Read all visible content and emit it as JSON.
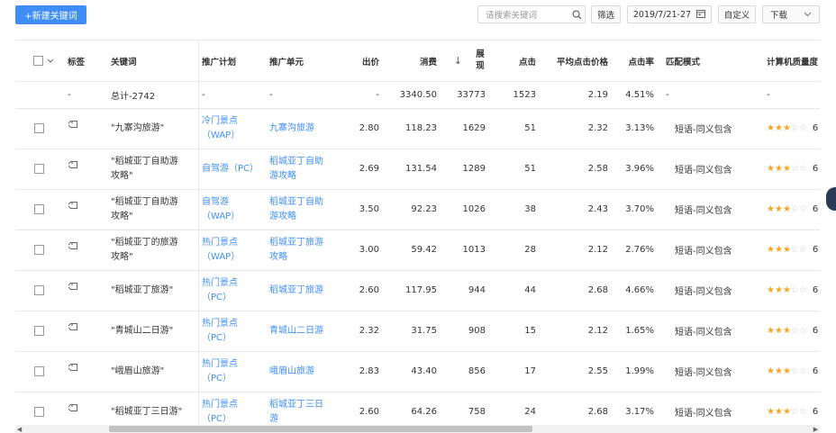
{
  "toolbar": {
    "new_keyword_label": "+新建关键词",
    "search_placeholder": "请搜索关键词",
    "filter_label": "筛选",
    "date_label": "2019/7/21-27",
    "custom_label": "自定义",
    "download_label": "下载"
  },
  "table": {
    "headers": {
      "tag": "标签",
      "keyword": "关键词",
      "plan": "推广计划",
      "unit": "推广单元",
      "bid": "出价",
      "spend": "消费",
      "impressions": "展现",
      "clicks": "点击",
      "avg_cpc": "平均点击价格",
      "ctr": "点击率",
      "match": "匹配模式",
      "quality": "计算机质量度"
    },
    "total": {
      "tag": "-",
      "keyword": "总计-2742",
      "plan": "-",
      "unit": "-",
      "bid": "-",
      "spend": "3340.50",
      "impressions": "33773",
      "clicks": "1523",
      "avg_cpc": "2.19",
      "ctr": "4.51%",
      "match": "-",
      "quality": "-"
    },
    "rows": [
      {
        "keyword": "\"九寨沟旅游\"",
        "plan": "冷门景点（WAP）",
        "unit": "九寨沟旅游",
        "bid": "2.80",
        "spend": "118.23",
        "impressions": "1629",
        "clicks": "51",
        "avg_cpc": "2.32",
        "ctr": "3.13%",
        "match": "短语-同义包含",
        "stars": 3,
        "quality_num": "6"
      },
      {
        "keyword": "\"稻城亚丁自助游攻略\"",
        "plan": "自驾游（PC）",
        "unit": "稻城亚丁自助游攻略",
        "bid": "2.69",
        "spend": "131.54",
        "impressions": "1289",
        "clicks": "51",
        "avg_cpc": "2.58",
        "ctr": "3.96%",
        "match": "短语-同义包含",
        "stars": 3,
        "quality_num": "6"
      },
      {
        "keyword": "\"稻城亚丁自助游攻略\"",
        "plan": "自驾游（WAP）",
        "unit": "稻城亚丁自助游攻略",
        "bid": "3.50",
        "spend": "92.23",
        "impressions": "1026",
        "clicks": "38",
        "avg_cpc": "2.43",
        "ctr": "3.70%",
        "match": "短语-同义包含",
        "stars": 3,
        "quality_num": "6"
      },
      {
        "keyword": "\"稻城亚丁的旅游攻略\"",
        "plan": "热门景点（WAP）",
        "unit": "稻城亚丁旅游攻略",
        "bid": "3.00",
        "spend": "59.42",
        "impressions": "1013",
        "clicks": "28",
        "avg_cpc": "2.12",
        "ctr": "2.76%",
        "match": "短语-同义包含",
        "stars": 3,
        "quality_num": "6"
      },
      {
        "keyword": "\"稻城亚丁旅游\"",
        "plan": "热门景点（PC）",
        "unit": "稻城亚丁旅游",
        "bid": "2.60",
        "spend": "117.95",
        "impressions": "944",
        "clicks": "44",
        "avg_cpc": "2.68",
        "ctr": "4.66%",
        "match": "短语-同义包含",
        "stars": 3,
        "quality_num": "6"
      },
      {
        "keyword": "\"青城山二日游\"",
        "plan": "热门景点（PC）",
        "unit": "青城山二日游",
        "bid": "2.32",
        "spend": "31.75",
        "impressions": "908",
        "clicks": "15",
        "avg_cpc": "2.12",
        "ctr": "1.65%",
        "match": "短语-同义包含",
        "stars": 3,
        "quality_num": "6"
      },
      {
        "keyword": "\"峨眉山旅游\"",
        "plan": "热门景点（PC）",
        "unit": "峨眉山旅游",
        "bid": "2.83",
        "spend": "43.40",
        "impressions": "856",
        "clicks": "17",
        "avg_cpc": "2.55",
        "ctr": "1.99%",
        "match": "短语-同义包含",
        "stars": 3,
        "quality_num": "6"
      },
      {
        "keyword": "\"稻城亚丁三日游\"",
        "plan": "热门景点（PC）",
        "unit": "稻城亚丁三日游",
        "bid": "2.60",
        "spend": "64.26",
        "impressions": "758",
        "clicks": "24",
        "avg_cpc": "2.68",
        "ctr": "3.17%",
        "match": "短语-同义包含",
        "stars": 3,
        "quality_num": "6"
      }
    ]
  },
  "icons": {
    "search": "search-icon",
    "calendar": "calendar-icon",
    "chevron": "chevron-down-icon",
    "tag": "tag-icon",
    "sort": "sort-desc-icon",
    "star": "star-icon"
  },
  "colors": {
    "primary": "#3f8ef7",
    "link": "#3f8ef7",
    "star": "#f5a623",
    "border": "#e8e8e8"
  }
}
